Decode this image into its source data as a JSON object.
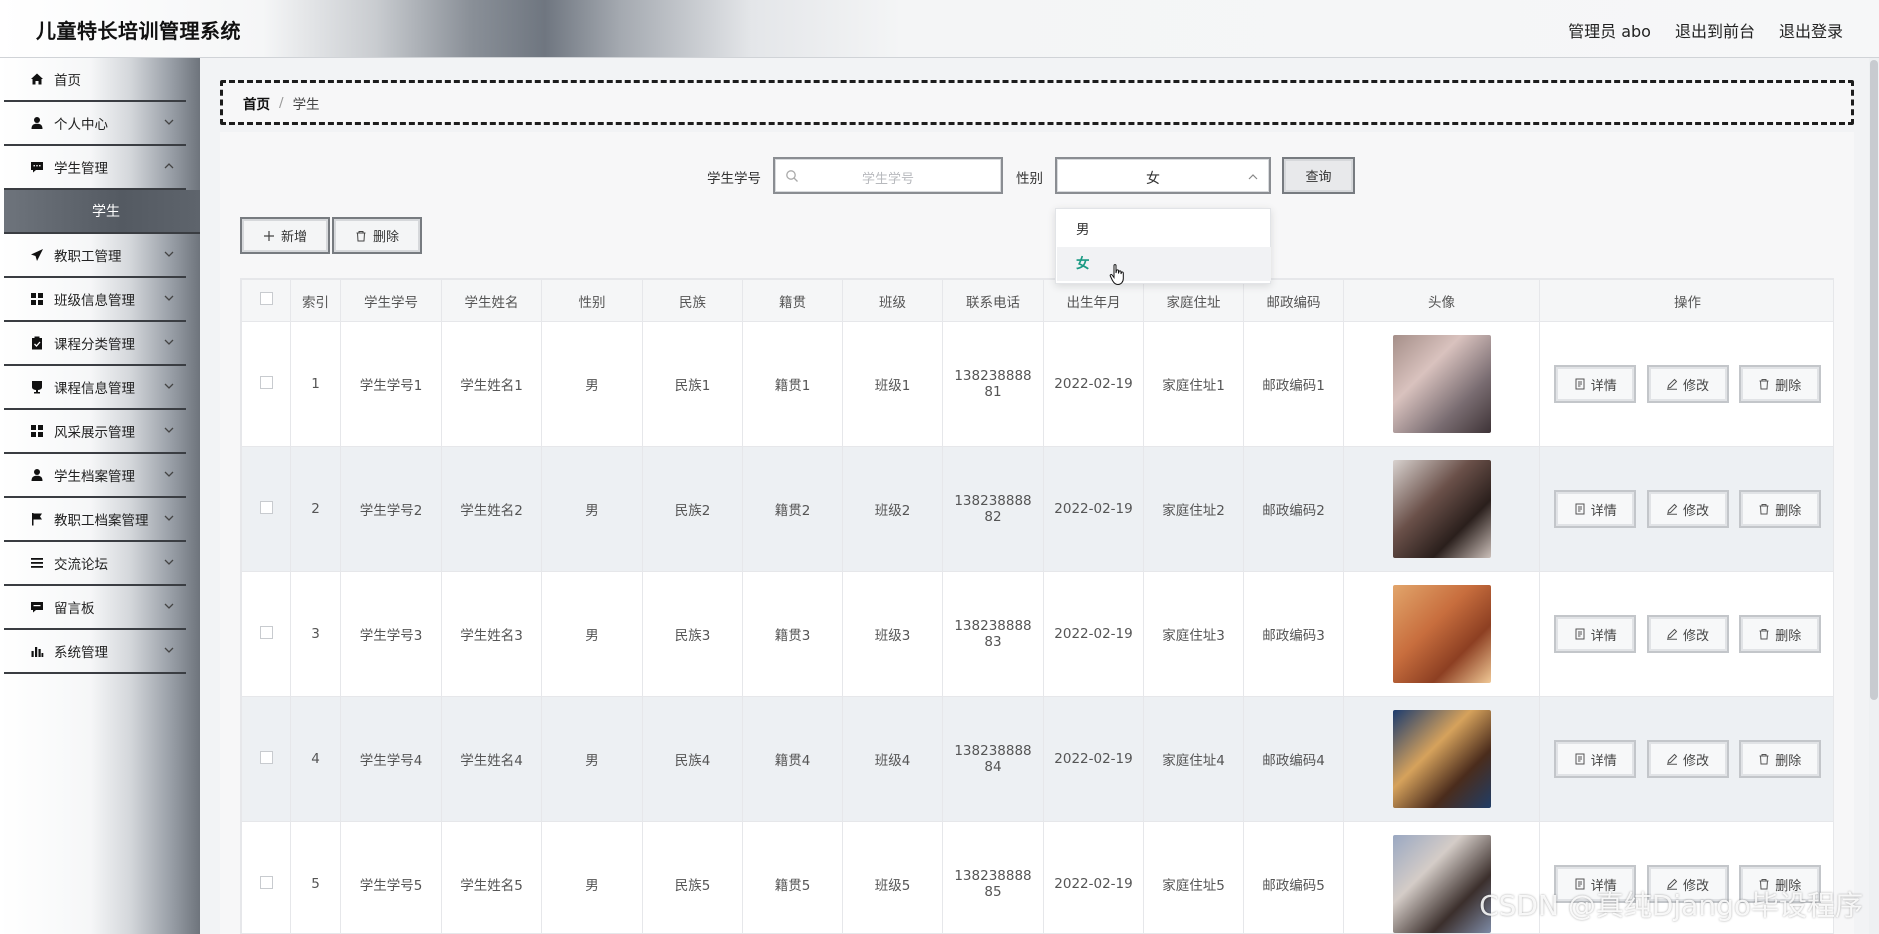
{
  "app": {
    "title": "儿童特长培训管理系统"
  },
  "header": {
    "admin_label": "管理员 abo",
    "frontend_link": "退出到前台",
    "logout_link": "退出登录"
  },
  "sidebar": {
    "items": [
      {
        "label": "首页",
        "icon": "home-icon"
      },
      {
        "label": "个人中心",
        "icon": "user-icon"
      },
      {
        "label": "学生管理",
        "icon": "message-icon"
      },
      {
        "label": "学生",
        "icon": ""
      },
      {
        "label": "教职工管理",
        "icon": "send-icon"
      },
      {
        "label": "班级信息管理",
        "icon": "grid-icon"
      },
      {
        "label": "课程分类管理",
        "icon": "clipboard-icon"
      },
      {
        "label": "课程信息管理",
        "icon": "cup-icon"
      },
      {
        "label": "风采展示管理",
        "icon": "grid-icon"
      },
      {
        "label": "学生档案管理",
        "icon": "user-icon"
      },
      {
        "label": "教职工档案管理",
        "icon": "flag-icon"
      },
      {
        "label": "交流论坛",
        "icon": "list-icon"
      },
      {
        "label": "留言板",
        "icon": "message-icon"
      },
      {
        "label": "系统管理",
        "icon": "chart-icon"
      }
    ]
  },
  "breadcrumb": {
    "home": "首页",
    "separator": "/",
    "current": "学生"
  },
  "search": {
    "student_id_label": "学生学号",
    "student_id_placeholder": "学生学号",
    "gender_label": "性别",
    "gender_value": "女",
    "query_button": "查询"
  },
  "dropdown": {
    "options": [
      "男",
      "女"
    ],
    "highlighted": "女"
  },
  "actions": {
    "add": "新增",
    "delete": "删除"
  },
  "table": {
    "headers": [
      "索引",
      "学生学号",
      "学生姓名",
      "性别",
      "民族",
      "籍贯",
      "班级",
      "联系电话",
      "出生年月",
      "家庭住址",
      "邮政编码",
      "头像",
      "操作"
    ],
    "row_actions": {
      "detail": "详情",
      "edit": "修改",
      "delete": "删除"
    },
    "rows": [
      {
        "index": "1",
        "student_id": "学生学号1",
        "name": "学生姓名1",
        "gender": "男",
        "ethnicity": "民族1",
        "native": "籍贯1",
        "class": "班级1",
        "phone_a": "138238888",
        "phone_b": "81",
        "birth": "2022-02-19",
        "address": "家庭住址1",
        "zip": "邮政编码1"
      },
      {
        "index": "2",
        "student_id": "学生学号2",
        "name": "学生姓名2",
        "gender": "男",
        "ethnicity": "民族2",
        "native": "籍贯2",
        "class": "班级2",
        "phone_a": "138238888",
        "phone_b": "82",
        "birth": "2022-02-19",
        "address": "家庭住址2",
        "zip": "邮政编码2"
      },
      {
        "index": "3",
        "student_id": "学生学号3",
        "name": "学生姓名3",
        "gender": "男",
        "ethnicity": "民族3",
        "native": "籍贯3",
        "class": "班级3",
        "phone_a": "138238888",
        "phone_b": "83",
        "birth": "2022-02-19",
        "address": "家庭住址3",
        "zip": "邮政编码3"
      },
      {
        "index": "4",
        "student_id": "学生学号4",
        "name": "学生姓名4",
        "gender": "男",
        "ethnicity": "民族4",
        "native": "籍贯4",
        "class": "班级4",
        "phone_a": "138238888",
        "phone_b": "84",
        "birth": "2022-02-19",
        "address": "家庭住址4",
        "zip": "邮政编码4"
      },
      {
        "index": "5",
        "student_id": "学生学号5",
        "name": "学生姓名5",
        "gender": "男",
        "ethnicity": "民族5",
        "native": "籍贯5",
        "class": "班级5",
        "phone_a": "138238888",
        "phone_b": "85",
        "birth": "2022-02-19",
        "address": "家庭住址5",
        "zip": "邮政编码5"
      }
    ]
  },
  "watermark": "CSDN @真纯Django毕设程序",
  "colors": {
    "accent": "#1a9a83",
    "sidebar_active": "#5a6068"
  }
}
